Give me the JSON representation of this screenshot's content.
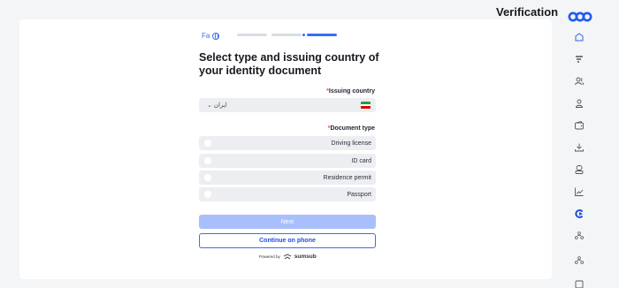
{
  "header": {
    "title": "Verification"
  },
  "language": {
    "label": "Fa"
  },
  "progress": {
    "total_steps": 3,
    "current_step": 3
  },
  "form": {
    "heading": "Select type and issuing country of your identity document",
    "required_mark": "*",
    "country_label": "Issuing country",
    "country_value": "ایران",
    "document_label": "Document type",
    "options": [
      {
        "label": "Driving license"
      },
      {
        "label": "ID card"
      },
      {
        "label": "Residence permit"
      },
      {
        "label": "Passport"
      }
    ],
    "next_label": "Next",
    "phone_label": "Continue on phone",
    "powered_prefix": "Powered by",
    "powered_brand": "sumsub"
  },
  "sidebar": {
    "icons": [
      "home-icon",
      "filter-icon",
      "users-icon",
      "user-icon",
      "wallet-icon",
      "download-icon",
      "profile-icon",
      "chart-icon",
      "exchange-icon",
      "referral-icon",
      "referral-alt-icon",
      "more-icon"
    ]
  },
  "colors": {
    "accent": "#3b6cf5",
    "accent_disabled": "#a9bffb",
    "logo": "#1f5cf0",
    "required": "#e5484d"
  }
}
